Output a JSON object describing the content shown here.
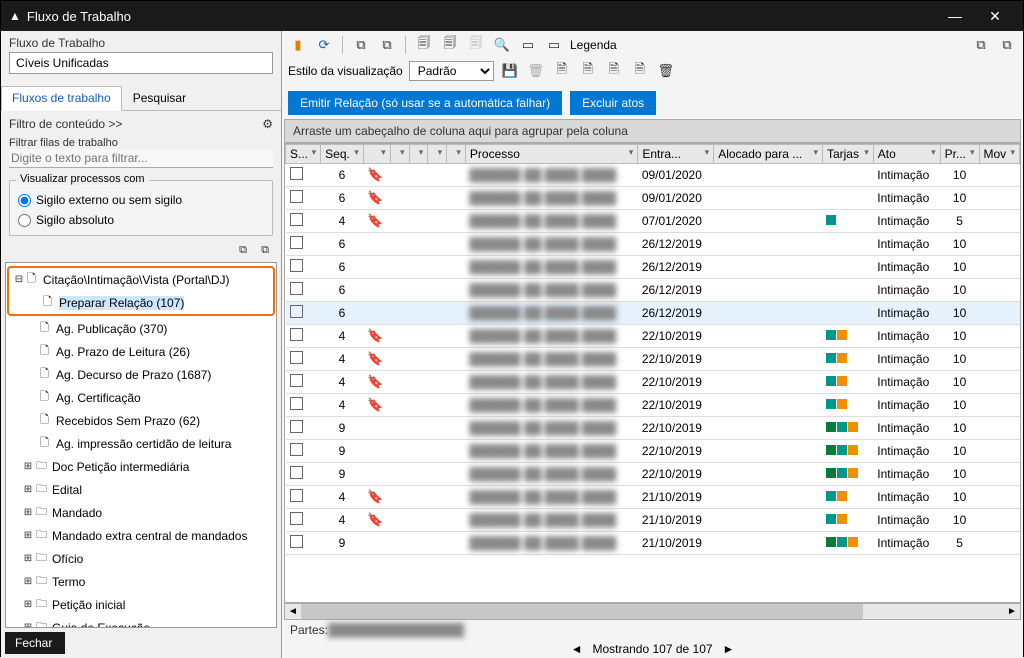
{
  "window_title": "Fluxo de Trabalho",
  "left": {
    "header": "Fluxo de Trabalho",
    "combo": "Cíveis Unificadas",
    "tabs": [
      "Fluxos de trabalho",
      "Pesquisar"
    ],
    "filter_link": "Filtro de conteúdo >>",
    "filter_label": "Filtrar filas de trabalho",
    "filter_placeholder": "Digite o texto para filtrar...",
    "group_legend": "Visualizar processos com",
    "radio1": "Sigilo externo ou sem sigilo",
    "radio2": "Sigilo absoluto",
    "tree": {
      "root": "Citação\\Intimação\\Vista (Portal\\DJ)",
      "children": [
        "Preparar Relação (107)",
        "Ag. Publicação (370)",
        "Ag. Prazo de Leitura (26)",
        "Ag. Decurso de Prazo (1687)",
        "Ag. Certificação",
        "Recebidos Sem Prazo (62)",
        "Ag. impressão certidão de leitura"
      ],
      "siblings": [
        "Doc Petição intermediária",
        "Edital",
        "Mandado",
        "Mandado extra central de mandados",
        "Ofício",
        "Termo",
        "Petição inicial",
        "Guia de Execução"
      ]
    },
    "footer": "Fechar"
  },
  "right": {
    "legend_label": "Legenda",
    "style_label": "Estilo da visualização",
    "style_value": "Padrão",
    "btn_emitir": "Emitir Relação (só usar se a automática falhar)",
    "btn_excluir": "Excluir atos",
    "group_bar": "Arraste um cabeçalho de coluna aqui para agrupar pela coluna",
    "columns": [
      "S...",
      "Seq.",
      "",
      "",
      "",
      "",
      "",
      "Processo",
      "Entra...",
      "Alocado para ...",
      "Tarjas",
      "Ato",
      "Pr...",
      "Mov"
    ],
    "rows": [
      {
        "seq": "6",
        "bm": true,
        "date": "09/01/2020",
        "tags": [],
        "ato": "Intimação",
        "pr": "10"
      },
      {
        "seq": "6",
        "bm": true,
        "date": "09/01/2020",
        "tags": [],
        "ato": "Intimação",
        "pr": "10"
      },
      {
        "seq": "4",
        "bm": true,
        "date": "07/01/2020",
        "tags": [
          "teal"
        ],
        "ato": "Intimação",
        "pr": "5"
      },
      {
        "seq": "6",
        "bm": false,
        "date": "26/12/2019",
        "tags": [],
        "ato": "Intimação",
        "pr": "10"
      },
      {
        "seq": "6",
        "bm": false,
        "date": "26/12/2019",
        "tags": [],
        "ato": "Intimação",
        "pr": "10"
      },
      {
        "seq": "6",
        "bm": false,
        "date": "26/12/2019",
        "tags": [],
        "ato": "Intimação",
        "pr": "10"
      },
      {
        "seq": "6",
        "bm": false,
        "date": "26/12/2019",
        "tags": [],
        "ato": "Intimação",
        "pr": "10",
        "sel": true
      },
      {
        "seq": "4",
        "bm": true,
        "date": "22/10/2019",
        "tags": [
          "teal",
          "orange"
        ],
        "ato": "Intimação",
        "pr": "10"
      },
      {
        "seq": "4",
        "bm": true,
        "date": "22/10/2019",
        "tags": [
          "teal",
          "orange"
        ],
        "ato": "Intimação",
        "pr": "10"
      },
      {
        "seq": "4",
        "bm": true,
        "date": "22/10/2019",
        "tags": [
          "teal",
          "orange"
        ],
        "ato": "Intimação",
        "pr": "10"
      },
      {
        "seq": "4",
        "bm": true,
        "date": "22/10/2019",
        "tags": [
          "teal",
          "orange"
        ],
        "ato": "Intimação",
        "pr": "10"
      },
      {
        "seq": "9",
        "bm": false,
        "date": "22/10/2019",
        "tags": [
          "green",
          "teal",
          "orange"
        ],
        "ato": "Intimação",
        "pr": "10"
      },
      {
        "seq": "9",
        "bm": false,
        "date": "22/10/2019",
        "tags": [
          "green",
          "teal",
          "orange"
        ],
        "ato": "Intimação",
        "pr": "10"
      },
      {
        "seq": "9",
        "bm": false,
        "date": "22/10/2019",
        "tags": [
          "green",
          "teal",
          "orange"
        ],
        "ato": "Intimação",
        "pr": "10"
      },
      {
        "seq": "4",
        "bm": true,
        "date": "21/10/2019",
        "tags": [
          "teal",
          "orange"
        ],
        "ato": "Intimação",
        "pr": "10"
      },
      {
        "seq": "4",
        "bm": true,
        "date": "21/10/2019",
        "tags": [
          "teal",
          "orange"
        ],
        "ato": "Intimação",
        "pr": "10"
      },
      {
        "seq": "9",
        "bm": false,
        "date": "21/10/2019",
        "tags": [
          "green",
          "teal",
          "orange"
        ],
        "ato": "Intimação",
        "pr": "5"
      }
    ],
    "partes_label": "Partes:",
    "pager": "Mostrando 107 de 107"
  }
}
